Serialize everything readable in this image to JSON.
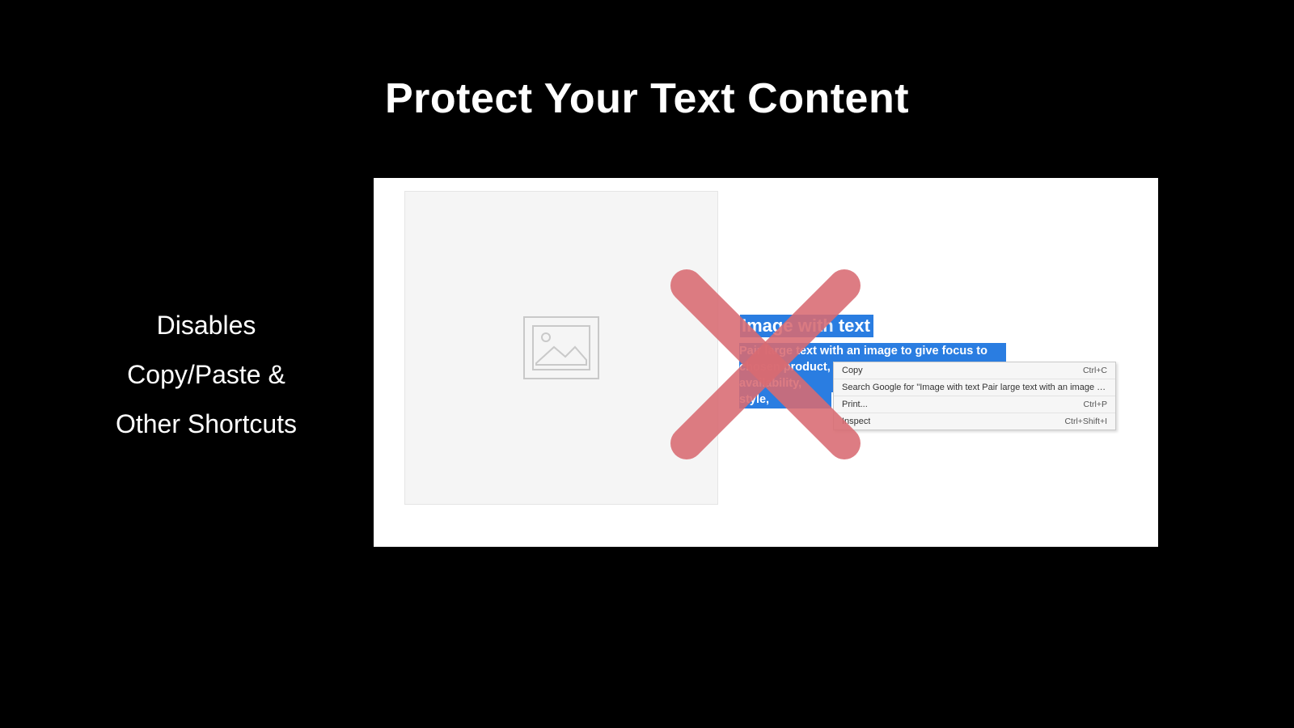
{
  "headline": "Protect Your Text Content",
  "subtext": {
    "line1": "Disables",
    "line2": "Copy/Paste &",
    "line3": "Other Shortcuts"
  },
  "selected": {
    "heading_part1": "Image",
    "heading_part2": "with",
    "heading_part3": "text",
    "line1": "Pair large text with an image to give focus to your",
    "line2": "chosen product, c",
    "line3": "availability, style,"
  },
  "context_menu": {
    "items": [
      {
        "label": "Copy",
        "shortcut": "Ctrl+C"
      },
      {
        "label": "Search Google for \"Image with text Pair large text with an image to...\"",
        "shortcut": ""
      },
      {
        "label": "Print...",
        "shortcut": "Ctrl+P"
      },
      {
        "label": "Inspect",
        "shortcut": "Ctrl+Shift+I"
      }
    ]
  }
}
